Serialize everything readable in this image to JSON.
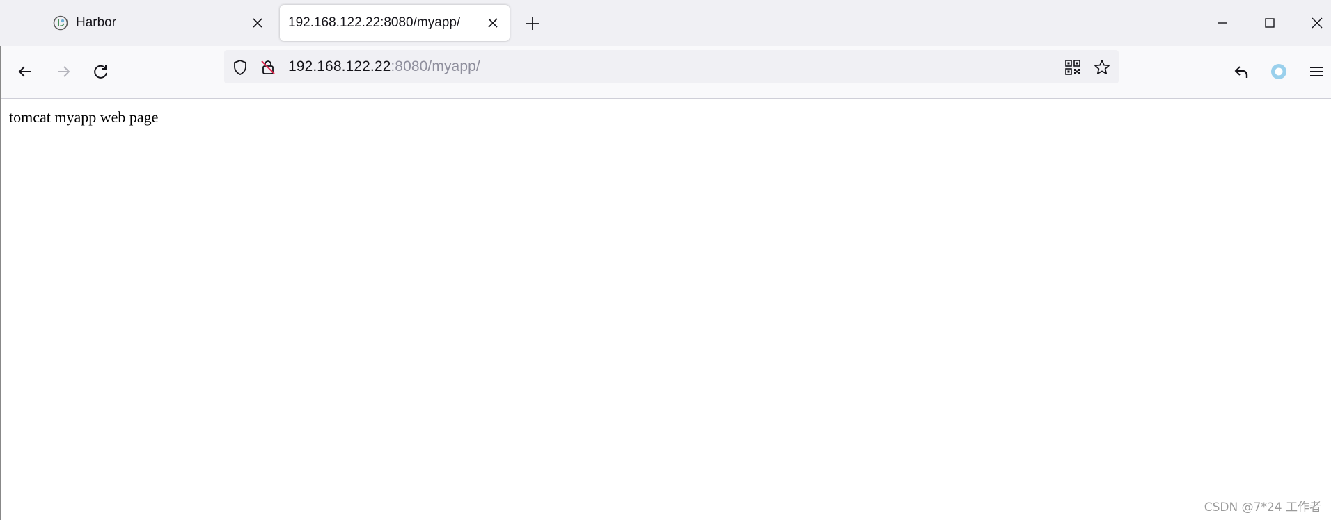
{
  "tabs": [
    {
      "label": "Harbor",
      "active": false,
      "favicon": "harbor-logo-icon"
    },
    {
      "label": "192.168.122.22:8080/myapp/",
      "active": true
    }
  ],
  "toolbar": {
    "url_host": "192.168.122.22",
    "url_rest": ":8080/myapp/"
  },
  "page": {
    "body_text": "tomcat myapp web page"
  },
  "watermark": "CSDN @7*24 工作者",
  "colors": {
    "tabstrip_bg": "#f0f0f4",
    "toolbar_bg": "#f9f9fb",
    "urlbar_bg": "#f0f0f4",
    "profile_accent": "#9ad0ec",
    "url_dim": "#8f8f9d"
  },
  "icons": {
    "back": "arrow-left-icon",
    "forward": "arrow-right-icon",
    "reload": "reload-icon",
    "tracking": "shield-icon",
    "insecure": "insecure-lock-icon",
    "qr": "qr-code-icon",
    "bookmark": "star-icon",
    "undo": "undo-arrow-icon",
    "profile": "profile-circle-icon",
    "menu": "hamburger-menu-icon",
    "minimize": "minimize-icon",
    "maximize": "maximize-icon",
    "close": "close-window-icon"
  }
}
